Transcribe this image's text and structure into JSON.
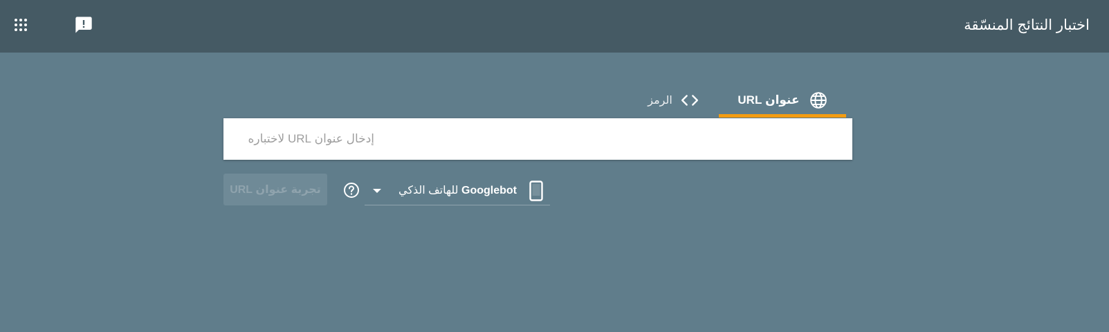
{
  "header": {
    "title": "اختبار النتائج المنسّقة",
    "apps_icon": "apps-grid-icon",
    "feedback_icon": "feedback-icon"
  },
  "tabs": [
    {
      "label": "عنوان URL",
      "icon": "globe-icon",
      "active": true
    },
    {
      "label": "الرمز",
      "icon": "code-icon",
      "active": false
    }
  ],
  "url_input": {
    "value": "",
    "placeholder": "إدخال عنوان URL لاختباره"
  },
  "user_agent": {
    "name": "Googlebot",
    "suffix": "للهاتف الذكي",
    "icon": "smartphone-icon"
  },
  "help_icon": "help-circle-icon",
  "test_button": {
    "label": "تجربة عنوان URL",
    "enabled": false
  },
  "colors": {
    "header_bg": "#455a64",
    "page_bg": "#607d8b",
    "tab_indicator": "#f39c12"
  }
}
